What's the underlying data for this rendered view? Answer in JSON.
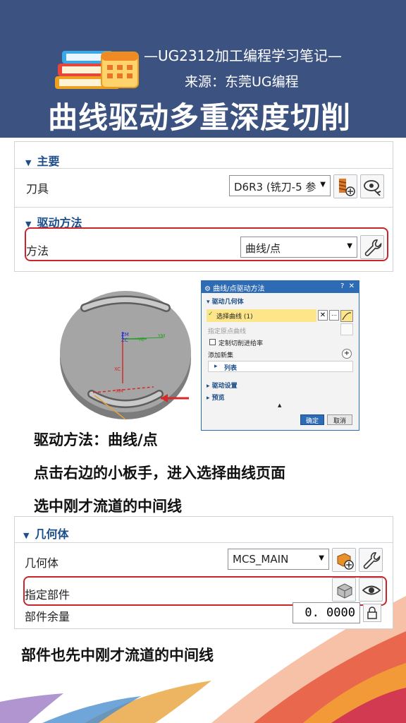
{
  "header": {
    "subtitle_line1": "—UG2312加工编程学习笔记—",
    "subtitle_line2": "来源：东莞UG编程",
    "title": "曲线驱动多重深度切削",
    "colors": {
      "banner": "#3c5382",
      "text": "#ffffff"
    },
    "icon": "books-calendar-icon"
  },
  "panel_top": {
    "main_section": "主要",
    "tool_label": "刀具",
    "tool_value": "D6R3 (铣刀-5 参",
    "drive_section": "驱动方法",
    "method_label": "方法",
    "method_value": "曲线/点"
  },
  "dialog": {
    "title": "曲线/点驱动方法",
    "help": "?",
    "close": "✕",
    "drive_geometry": "驱动几何体",
    "select_curve": "选择曲线 (1)",
    "specify_origin_curve": "指定原点曲线",
    "custom_feed": "定制切削进给率",
    "add_new_set": "添加新集",
    "list": "列表",
    "drive_settings": "驱动设置",
    "preview": "预览",
    "ok": "确定",
    "cancel": "取消"
  },
  "model_labels": {
    "zm": "ZM",
    "zc": "ZC",
    "yc": "YC",
    "ym": "YM",
    "xc": "XC",
    "xm": "XM"
  },
  "captions": {
    "line1": "驱动方法：曲线/点",
    "line2": "点击右边的小板手，进入选择曲线页面",
    "line3": "选中刚才流道的中间线",
    "line4": "部件也先中刚才流道的中间线"
  },
  "panel_geometry": {
    "section": "几何体",
    "geometry_label": "几何体",
    "geometry_value": "MCS_MAIN",
    "specify_part": "指定部件",
    "part_stock_label": "部件余量",
    "part_stock_value": "0. 0000"
  },
  "colors": {
    "accent_blue": "#1d4f8a",
    "highlight_red": "#c8262b",
    "selection_yellow": "#fde58a"
  }
}
